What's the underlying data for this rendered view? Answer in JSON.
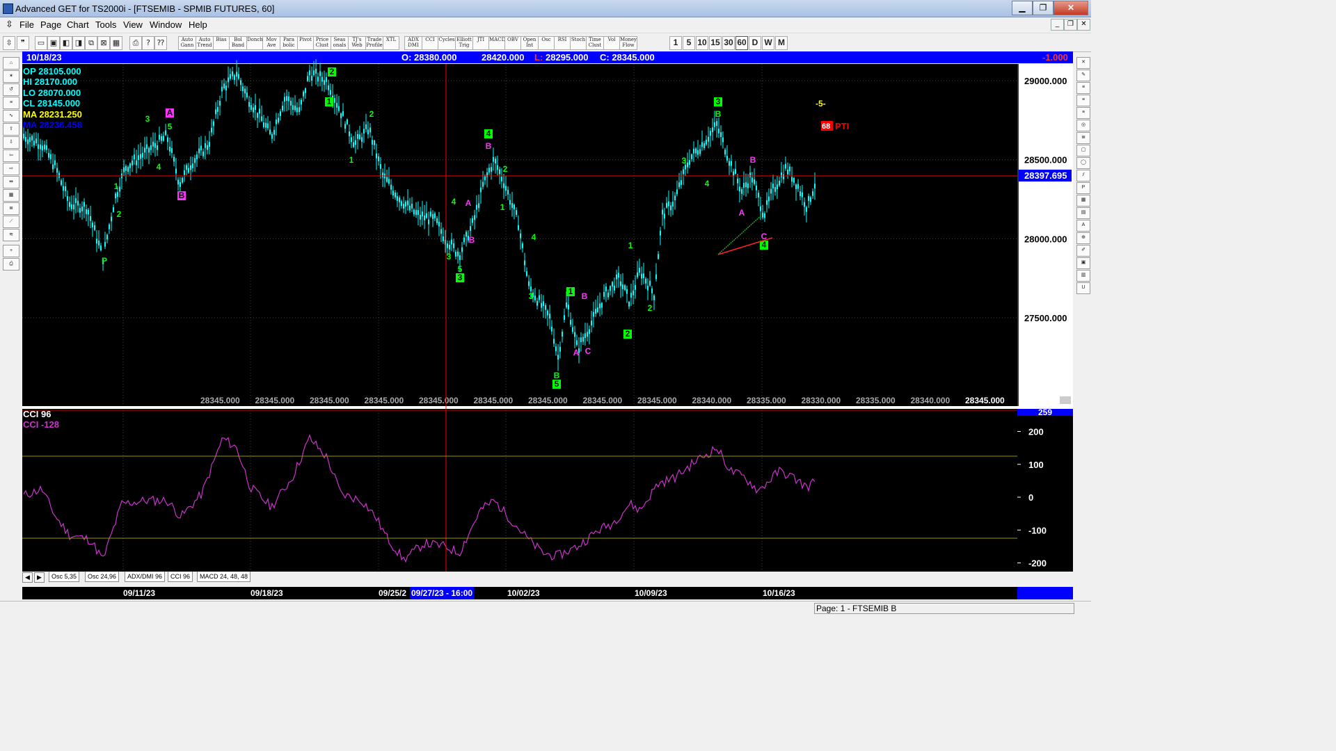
{
  "window": {
    "title": "Advanced GET for TS2000i - [FTSEMIB - SPMIB FUTURES, 60]",
    "min": "▁",
    "max": "❐",
    "close": "✕"
  },
  "menu": [
    "File",
    "Page",
    "Chart",
    "Tools",
    "View",
    "Window",
    "Help"
  ],
  "toolbar": {
    "studies": [
      {
        "name": "auto-gann",
        "label": "Auto Gann"
      },
      {
        "name": "auto-trend",
        "label": "Auto Trend"
      },
      {
        "name": "bias",
        "label": "Bias"
      },
      {
        "name": "bol-band",
        "label": "Bol Band"
      },
      {
        "name": "donch",
        "label": "Donch"
      },
      {
        "name": "mov-ave",
        "label": "Mov Ave"
      },
      {
        "name": "parabolic",
        "label": "Para bolic"
      },
      {
        "name": "pivot",
        "label": "Pivot"
      },
      {
        "name": "price-clust",
        "label": "Price Clust"
      },
      {
        "name": "seasonals",
        "label": "Seas onals"
      },
      {
        "name": "tjs-web",
        "label": "TJ's Web"
      },
      {
        "name": "trade-profile",
        "label": "Trade Profile"
      },
      {
        "name": "xtl",
        "label": "XTL"
      },
      {
        "name": "adx-dmi",
        "label": "ADX DMI"
      },
      {
        "name": "cci",
        "label": "CCI"
      },
      {
        "name": "cycles",
        "label": "Cycles"
      },
      {
        "name": "elliott-trig",
        "label": "Elliott Trig"
      },
      {
        "name": "jti",
        "label": "JTI"
      },
      {
        "name": "macd",
        "label": "MACD"
      },
      {
        "name": "obv",
        "label": "OBV"
      },
      {
        "name": "open-int",
        "label": "Open Int"
      },
      {
        "name": "osc",
        "label": "Osc"
      },
      {
        "name": "rsi",
        "label": "RSI"
      },
      {
        "name": "stoch",
        "label": "Stoch"
      },
      {
        "name": "time-clust",
        "label": "Time Clust"
      },
      {
        "name": "vol",
        "label": "Vol"
      },
      {
        "name": "money-flow",
        "label": "Money Flow"
      }
    ],
    "periods": [
      "1",
      "5",
      "10",
      "15",
      "30",
      "60",
      "D",
      "W",
      "M"
    ],
    "active_period": "60"
  },
  "left_tools": [
    "open",
    "gann",
    "reset",
    "study",
    "elliott",
    "up",
    "down",
    "left",
    "right",
    "zoom",
    "grid",
    "lines",
    "gann-fan",
    "fib",
    "cross",
    "print"
  ],
  "right_tools": [
    "cross",
    "pen",
    "fib-ret",
    "fib-ext",
    "fib-time",
    "spiral",
    "lines",
    "box",
    "ellipse",
    "channel",
    "pti",
    "grid",
    "mob",
    "text",
    "zoom",
    "paint",
    "page",
    "layers",
    "magnet"
  ],
  "infobar": {
    "date": "10/18/23",
    "open": "O: 28380.000",
    "high": "28420.000",
    "low_label": "L:",
    "low": "28295.000",
    "close": "C: 28345.000",
    "change": "-1.000"
  },
  "readout": {
    "op": "OP  28105.000",
    "hi": "HI   28170.000",
    "lo": "LO  28070.000",
    "cl": "CL  28145.000",
    "ma1": "MA  28231.250",
    "ma2": "MA  28236.458"
  },
  "price_axis": {
    "ticks": [
      "29000.000",
      "28500.000",
      "28000.000",
      "27500.000"
    ],
    "ticks_values": [
      29000,
      28500,
      28000,
      27500
    ],
    "current": "28397.695",
    "current_value": 28397.695
  },
  "bottom_prices": [
    "28345.000",
    "28345.000",
    "28345.000",
    "28345.000",
    "28345.000",
    "28345.000",
    "28345.000",
    "28345.000",
    "28345.000",
    "28340.000",
    "28335.000",
    "28330.000",
    "28335.000",
    "28340.000",
    "28345.000"
  ],
  "annotations": {
    "wave5": "-5-",
    "pti_value": "68",
    "pti_label": "PTI"
  },
  "cci": {
    "title": "CCI 96",
    "value_label": "CCI  -128",
    "ticks": [
      "200",
      "100",
      "0",
      "-100",
      "-200"
    ],
    "ticks_values": [
      200,
      100,
      0,
      -100,
      -200
    ],
    "top_value": "259"
  },
  "tabs": [
    "Osc 5,35",
    "Osc 24,96",
    "ADX/DMI 96",
    "CCI 96",
    "MACD 24, 48, 48"
  ],
  "active_tab": "CCI 96",
  "dates": [
    "09/11/23",
    "09/18/23",
    "09/25/2",
    "10/02/23",
    "10/09/23",
    "10/16/23"
  ],
  "cursor_date": "09/27/23 - 16:00",
  "status": "Page: 1 - FTSEMIB B",
  "colors": {
    "price_bars": "#00ffff",
    "ma_fast": "#ffff00",
    "ma_slow": "#0000ff",
    "cci_line": "#cc33cc",
    "wave_green": "#00ff00",
    "wave_magenta": "#ff33ff",
    "infobar": "#0000ff"
  }
}
